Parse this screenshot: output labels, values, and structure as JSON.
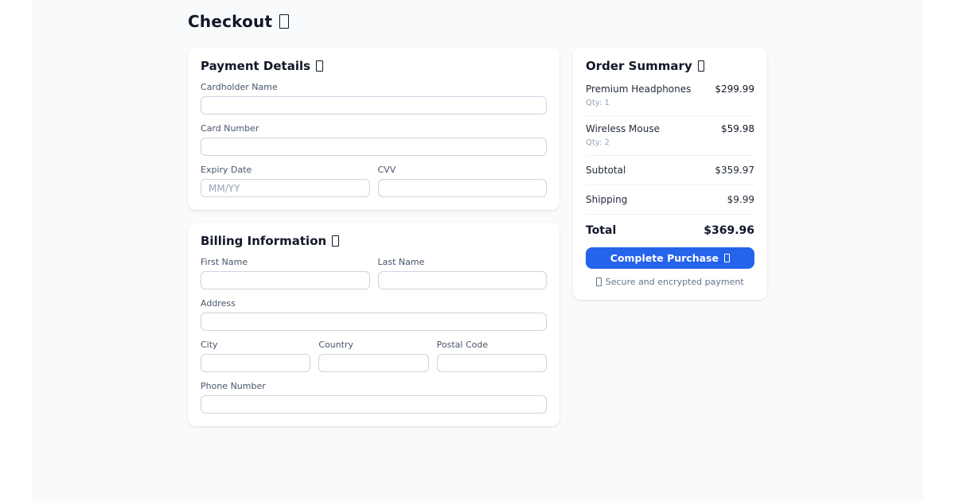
{
  "page": {
    "title": "Checkout"
  },
  "colors": {
    "accent": "#2563eb",
    "page_background": "#f8fafc",
    "card_background": "#ffffff"
  },
  "icons": {
    "title_emoji": "missing-glyph-box",
    "payment_emoji": "missing-glyph-box",
    "billing_emoji": "missing-glyph-box",
    "summary_emoji": "missing-glyph-box",
    "button_emoji": "missing-glyph-box",
    "secure_emoji": "missing-glyph-box"
  },
  "payment": {
    "heading": "Payment Details",
    "fields": {
      "cardholder": {
        "label": "Cardholder Name",
        "value": "",
        "placeholder": ""
      },
      "card_number": {
        "label": "Card Number",
        "value": "",
        "placeholder": ""
      },
      "expiry": {
        "label": "Expiry Date",
        "value": "",
        "placeholder": "MM/YY"
      },
      "cvv": {
        "label": "CVV",
        "value": "",
        "placeholder": ""
      }
    }
  },
  "billing": {
    "heading": "Billing Information",
    "fields": {
      "first_name": {
        "label": "First Name",
        "value": "",
        "placeholder": ""
      },
      "last_name": {
        "label": "Last Name",
        "value": "",
        "placeholder": ""
      },
      "address": {
        "label": "Address",
        "value": "",
        "placeholder": ""
      },
      "city": {
        "label": "City",
        "value": "",
        "placeholder": ""
      },
      "country": {
        "label": "Country",
        "value": "",
        "placeholder": ""
      },
      "postal_code": {
        "label": "Postal Code",
        "value": "",
        "placeholder": ""
      },
      "phone": {
        "label": "Phone Number",
        "value": "",
        "placeholder": ""
      }
    }
  },
  "order_summary": {
    "heading": "Order Summary",
    "items": [
      {
        "name": "Premium Headphones",
        "qty": "Qty: 1",
        "price": "$299.99"
      },
      {
        "name": "Wireless Mouse",
        "qty": "Qty: 2",
        "price": "$59.98"
      }
    ],
    "subtotal_label": "Subtotal",
    "subtotal_value": "$359.97",
    "shipping_label": "Shipping",
    "shipping_value": "$9.99",
    "total_label": "Total",
    "total_value": "$369.96",
    "purchase_button_label": "Complete Purchase",
    "secure_note": "Secure and encrypted payment"
  }
}
